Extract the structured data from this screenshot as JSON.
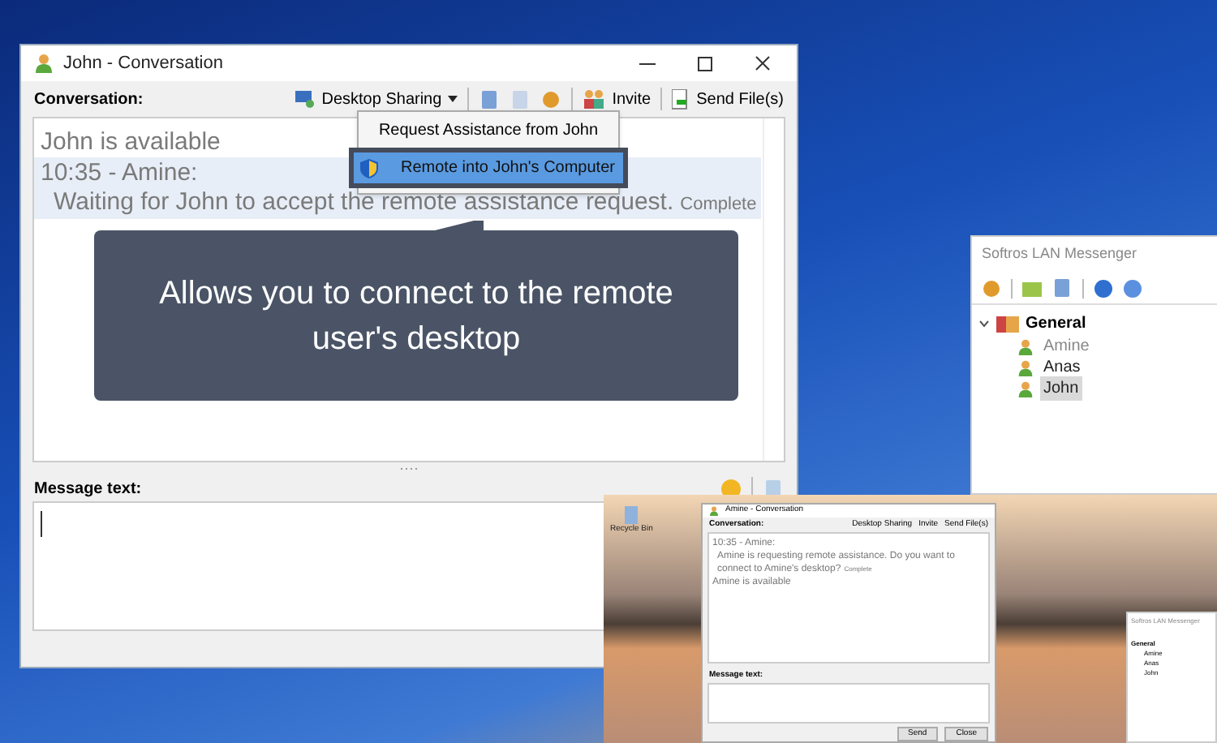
{
  "main_window": {
    "title": "John - Conversation",
    "conversation_label": "Conversation:",
    "toolbar": [
      {
        "kind": "dropdown",
        "label": "Desktop Sharing"
      },
      {
        "kind": "button",
        "label": "Invite"
      },
      {
        "kind": "button",
        "label": "Send File(s)"
      }
    ],
    "messages": [
      {
        "kind": "status",
        "text": "John is available",
        "highlighted": false
      },
      {
        "kind": "header",
        "text": "10:35 - Amine:",
        "highlighted": true
      },
      {
        "kind": "body",
        "text": "Waiting for John to accept the remote assistance request.",
        "note": "Complete",
        "highlighted": true
      }
    ],
    "menu": [
      {
        "label": "Request Assistance from John",
        "selected": false
      },
      {
        "label": "Remote into John's Computer",
        "selected": true
      }
    ],
    "callout": "Allows you to connect to the remote user's desktop",
    "message_label": "Message text:"
  },
  "messenger": {
    "title": "Softros LAN Messenger",
    "groups": [
      {
        "name": "General",
        "expanded": true,
        "children": [
          {
            "name": "Amine",
            "selected": false,
            "dimmed": true
          },
          {
            "name": "Anas",
            "selected": false,
            "dimmed": false
          },
          {
            "name": "John",
            "selected": true,
            "dimmed": false
          }
        ]
      }
    ]
  },
  "remote_view": {
    "desktop_icon": "Recycle Bin",
    "window_title": "Amine - Conversation",
    "conversation_label": "Conversation:",
    "toolbar": [
      "Desktop Sharing",
      "Invite",
      "Send File(s)"
    ],
    "messages": [
      {
        "kind": "header",
        "text": "10:35 - Amine:"
      },
      {
        "kind": "body",
        "text": "Amine is requesting remote assistance. Do you want to connect to Amine's desktop?",
        "note": "Complete"
      },
      {
        "kind": "status",
        "text": "Amine is available"
      }
    ],
    "message_label": "Message text:",
    "buttons": [
      "Send",
      "Close"
    ],
    "messenger": {
      "title": "Softros LAN Messenger",
      "group": "General",
      "members": [
        "Amine",
        "Anas",
        "John"
      ]
    }
  }
}
